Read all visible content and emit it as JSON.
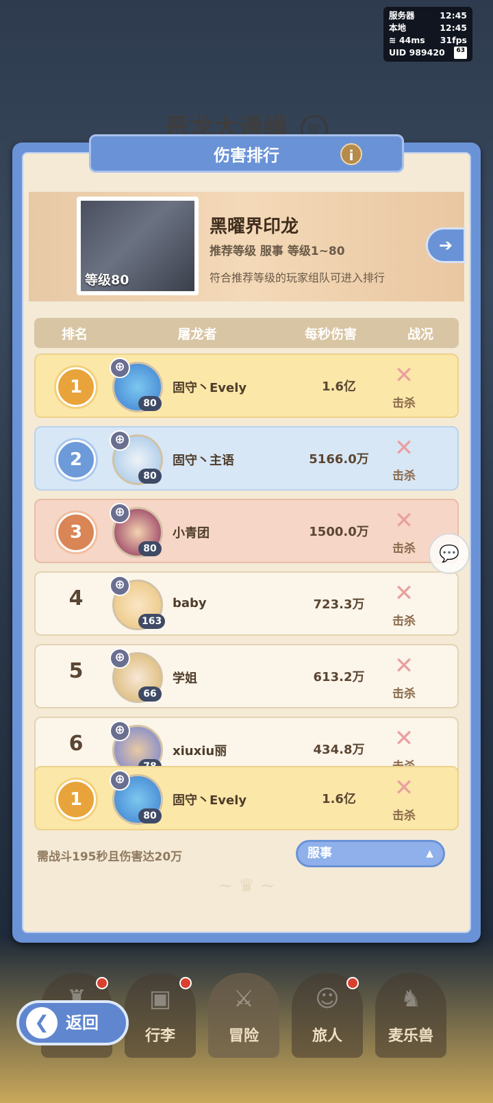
{
  "status": {
    "server_label": "服务器",
    "server_time": "12:45",
    "local_label": "本地",
    "local_time": "12:45",
    "ping": "44ms",
    "fps": "31fps",
    "uid": "UID 989420",
    "battery": "63"
  },
  "background": {
    "event_title": "恶龙大通缉"
  },
  "panel": {
    "title": "伤害排行",
    "info_icon": "i"
  },
  "boss": {
    "level": "等级80",
    "name": "黑曜界印龙",
    "recommend": "推荐等级 服事 等级1~80",
    "note": "符合推荐等级的玩家组队可进入排行"
  },
  "table": {
    "headers": {
      "rank": "排名",
      "player": "屠龙者",
      "dps": "每秒伤害",
      "status": "战况"
    },
    "rows": [
      {
        "rank": "1",
        "name": "固守丶Evely",
        "level": "80",
        "dps": "1.6亿",
        "status": "击杀"
      },
      {
        "rank": "2",
        "name": "固守丶主语",
        "level": "80",
        "dps": "5166.0万",
        "status": "击杀"
      },
      {
        "rank": "3",
        "name": "小青团",
        "level": "80",
        "dps": "1500.0万",
        "status": "击杀"
      },
      {
        "rank": "4",
        "name": "baby",
        "level": "163",
        "dps": "723.3万",
        "status": "击杀"
      },
      {
        "rank": "5",
        "name": "学姐",
        "level": "66",
        "dps": "613.2万",
        "status": "击杀"
      },
      {
        "rank": "6",
        "name": "xiuxiu丽",
        "level": "78",
        "dps": "434.8万",
        "status": "击杀"
      }
    ],
    "mine": {
      "rank": "1",
      "name": "固守丶Evely",
      "level": "80",
      "dps": "1.6亿",
      "status": "击杀"
    }
  },
  "footer": {
    "requirement": "需战斗195秒且伤害达20万",
    "server_select": "服事"
  },
  "nav": {
    "items": [
      {
        "label": "",
        "icon": "castle-icon"
      },
      {
        "label": "行李",
        "icon": "bag-icon"
      },
      {
        "label": "冒险",
        "icon": "swords-icon"
      },
      {
        "label": "旅人",
        "icon": "traveler-icon"
      },
      {
        "label": "麦乐兽",
        "icon": "pet-icon"
      }
    ],
    "back": "返回"
  },
  "colors": {
    "panel_blue": "#6a92d6",
    "gold_row": "#fbe7a8",
    "silver_row": "#d7e7f6",
    "bronze_row": "#f6d6c6",
    "notification_red": "#d9402f"
  }
}
